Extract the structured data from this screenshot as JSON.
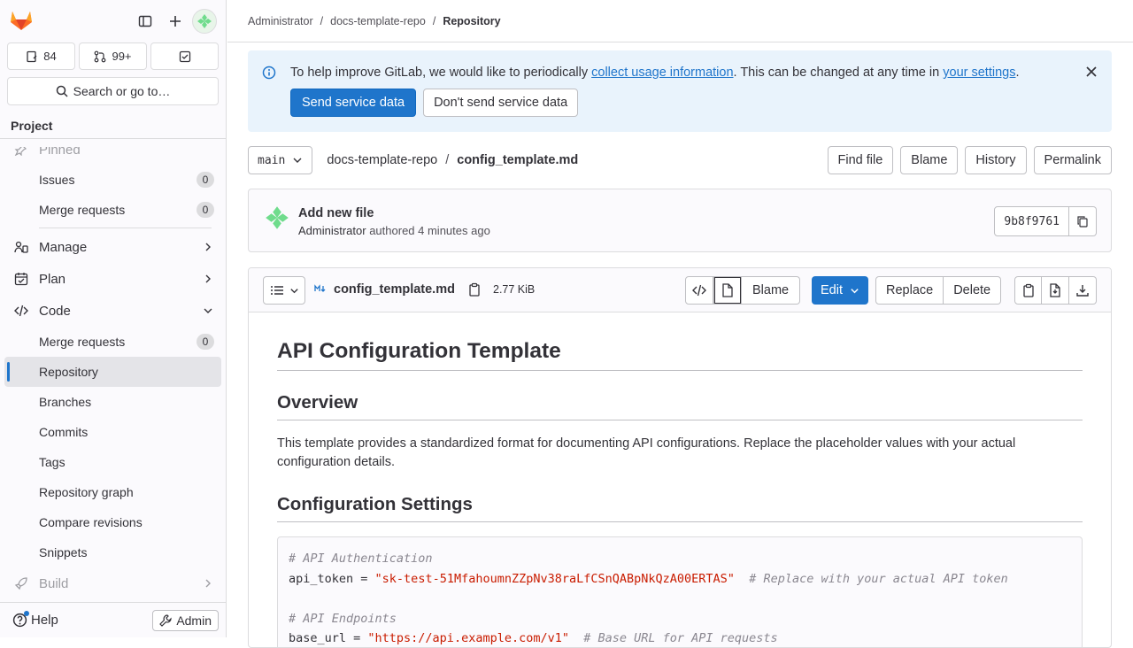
{
  "sidebar": {
    "issues_count": "84",
    "mr_count": "99+",
    "search_label": "Search or go to…",
    "context_label": "Project",
    "pinned_label": "Pinned",
    "pinned_items": [
      {
        "label": "Issues",
        "badge": "0"
      },
      {
        "label": "Merge requests",
        "badge": "0"
      }
    ],
    "sections": {
      "manage": "Manage",
      "plan": "Plan",
      "code": "Code",
      "build": "Build"
    },
    "code_items": [
      {
        "label": "Merge requests",
        "badge": "0"
      },
      {
        "label": "Repository"
      },
      {
        "label": "Branches"
      },
      {
        "label": "Commits"
      },
      {
        "label": "Tags"
      },
      {
        "label": "Repository graph"
      },
      {
        "label": "Compare revisions"
      },
      {
        "label": "Snippets"
      }
    ],
    "help_label": "Help",
    "admin_label": "Admin"
  },
  "breadcrumb": {
    "items": [
      "Administrator",
      "docs-template-repo"
    ],
    "current": "Repository"
  },
  "alert": {
    "text_before": "To help improve GitLab, we would like to periodically ",
    "link1": "collect usage information",
    "text_middle": ". This can be changed at any time in ",
    "link2": "your settings",
    "text_after": ".",
    "primary_button": "Send service data",
    "secondary_button": "Don't send service data"
  },
  "pathbar": {
    "branch": "main",
    "repo": "docs-template-repo",
    "separator": "/",
    "file": "config_template.md",
    "buttons": [
      "Find file",
      "Blame",
      "History",
      "Permalink"
    ]
  },
  "commit": {
    "title": "Add new file",
    "author": "Administrator",
    "meta": "authored 4 minutes ago",
    "sha": "9b8f9761"
  },
  "blob": {
    "filename": "config_template.md",
    "size": "2.77 KiB",
    "blame_label": "Blame",
    "edit_label": "Edit",
    "replace_label": "Replace",
    "delete_label": "Delete"
  },
  "document": {
    "h1": "API Configuration Template",
    "overview_heading": "Overview",
    "overview_text": "This template provides a standardized format for documenting API configurations. Replace the placeholder values with your actual configuration details.",
    "config_heading": "Configuration Settings",
    "code": {
      "comment1": "# API Authentication",
      "token_key": "api_token = ",
      "token_value": "\"sk-test-51MfahoumnZZpNv38raLfCSnQABpNkQzA00ERTAS\"",
      "token_comment": "  # Replace with your actual API token",
      "comment2": "# API Endpoints",
      "url_key": "base_url = ",
      "url_value": "\"https://api.example.com/v1\"",
      "url_comment": "  # Base URL for API requests"
    }
  },
  "colors": {
    "accent": "#1f75cb",
    "alert_bg": "#e9f3fc",
    "sidebar_bg": "#fbfafd"
  }
}
